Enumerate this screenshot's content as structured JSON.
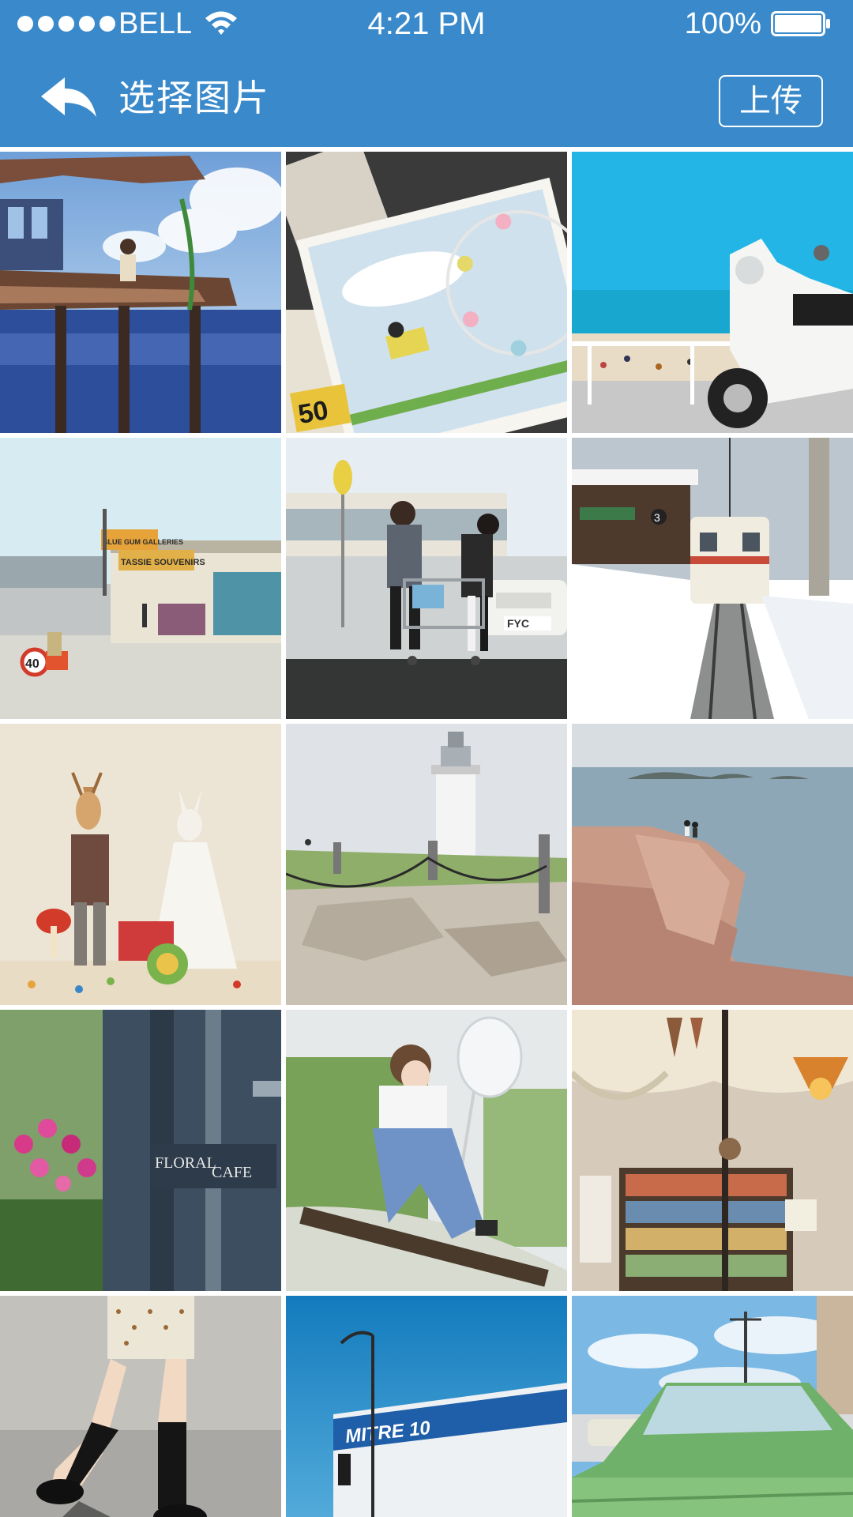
{
  "status_bar": {
    "carrier": "BELL",
    "time": "4:21 PM",
    "battery": "100%",
    "icons": [
      "signal-dots",
      "wifi-icon",
      "battery-icon"
    ]
  },
  "nav": {
    "back_icon": "back-arrow-icon",
    "title": "选择图片",
    "upload_label": "上传"
  },
  "photos": [
    {
      "name": "anime-girl-ruined-platform",
      "signs": []
    },
    {
      "name": "ferris-wheel-postcards",
      "signs": [
        "50"
      ]
    },
    {
      "name": "white-scooter-beach",
      "signs": []
    },
    {
      "name": "street-souvenir-shop",
      "signs": [
        "BLUE GUM GALLERIES",
        "TASSIE SOUVENIRS",
        "40"
      ]
    },
    {
      "name": "couple-shopping-cart",
      "signs": [
        "FYC"
      ]
    },
    {
      "name": "snowy-train-station",
      "signs": [
        "3",
        "3"
      ]
    },
    {
      "name": "deer-and-rabbit-wedding",
      "signs": []
    },
    {
      "name": "lighthouse-rocky-shore",
      "signs": []
    },
    {
      "name": "couple-on-sea-cliff",
      "signs": []
    },
    {
      "name": "floral-cafe-door",
      "signs": [
        "FLORAL",
        "CAFE"
      ]
    },
    {
      "name": "girl-with-butterfly-net",
      "signs": []
    },
    {
      "name": "cafe-interior-bookshelf",
      "signs": []
    },
    {
      "name": "walking-legs-knee-socks",
      "signs": []
    },
    {
      "name": "mitre10-store-sky",
      "signs": [
        "MITRE 10"
      ]
    },
    {
      "name": "green-vintage-car",
      "signs": []
    }
  ],
  "colors": {
    "header": "#3a8acb",
    "white": "#ffffff"
  }
}
